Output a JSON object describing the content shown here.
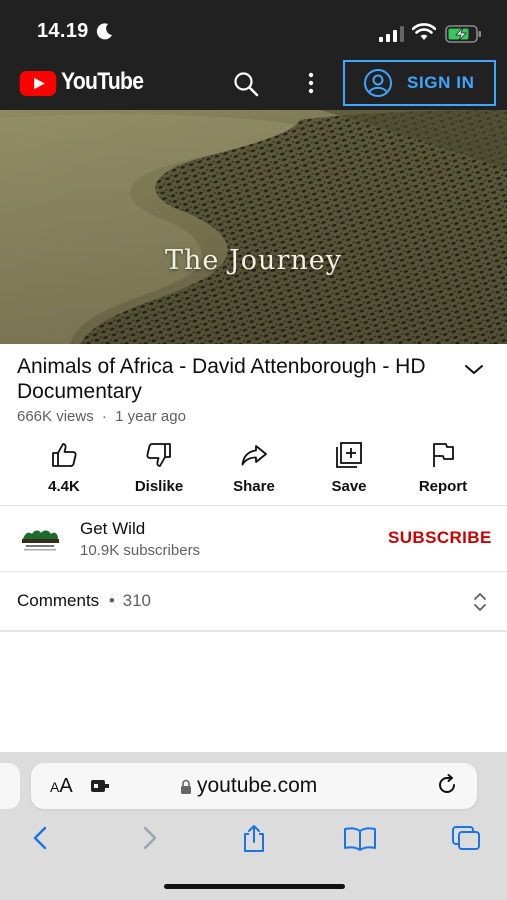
{
  "status_bar": {
    "time": "14.19"
  },
  "youtube_header": {
    "brand": "YouTube",
    "sign_in_label": "SIGN IN"
  },
  "video": {
    "overlay_text": "The Journey",
    "title": "Animals of Africa - David Attenborough - HD Documentary",
    "views": "666K views",
    "separator": "·",
    "age": "1 year ago"
  },
  "actions": [
    {
      "label": "4.4K",
      "icon": "thumbs-up-icon"
    },
    {
      "label": "Dislike",
      "icon": "thumbs-down-icon"
    },
    {
      "label": "Share",
      "icon": "share-icon"
    },
    {
      "label": "Save",
      "icon": "save-to-playlist-icon"
    },
    {
      "label": "Report",
      "icon": "flag-icon"
    }
  ],
  "channel": {
    "name": "Get Wild",
    "subscribers": "10.9K subscribers",
    "subscribe_label": "SUBSCRIBE"
  },
  "comments": {
    "label": "Comments",
    "dot": "•",
    "count": "310"
  },
  "browser": {
    "text_size_small": "A",
    "text_size_large": "A",
    "domain": "youtube.com"
  },
  "colors": {
    "header_bg": "#212121",
    "youtube_red": "#ff0000",
    "sign_in_blue": "#3ea6ff",
    "subscribe_red": "#cc0000",
    "safari_blue": "#1a73e8"
  }
}
